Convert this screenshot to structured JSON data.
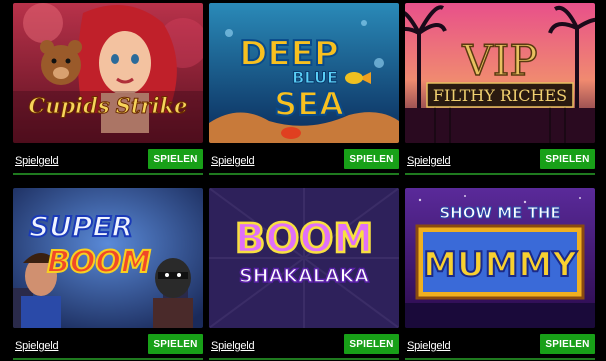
{
  "games": [
    {
      "title_lines": [
        "Cupids",
        "Strike"
      ],
      "demo_label": "Spielgeld",
      "play_label": "SPIELEN"
    },
    {
      "title_lines": [
        "DEEP",
        "BLUE",
        "SEA"
      ],
      "demo_label": "Spielgeld",
      "play_label": "SPIELEN"
    },
    {
      "title_lines": [
        "VIP",
        "FILTHY RICHES"
      ],
      "demo_label": "Spielgeld",
      "play_label": "SPIELEN"
    },
    {
      "title_lines": [
        "SUPER",
        "BOOM"
      ],
      "demo_label": "Spielgeld",
      "play_label": "SPIELEN"
    },
    {
      "title_lines": [
        "BOOM",
        "SHAKALAKA"
      ],
      "demo_label": "Spielgeld",
      "play_label": "SPIELEN"
    },
    {
      "title_lines": [
        "SHOW ME THE",
        "MUMMY"
      ],
      "demo_label": "Spielgeld",
      "play_label": "SPIELEN"
    }
  ],
  "colors": {
    "play_button": "#18a018",
    "card_underline": "#1f7a1f",
    "background": "#000000"
  }
}
